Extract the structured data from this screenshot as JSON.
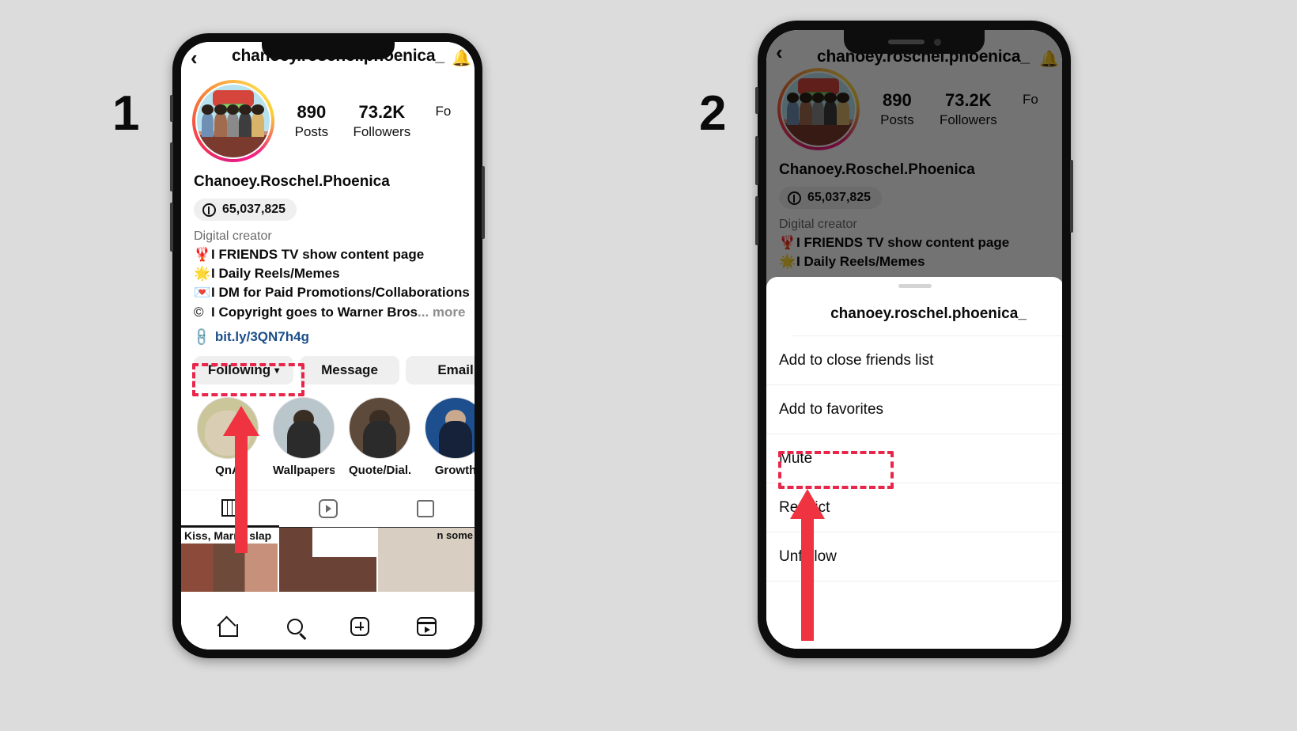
{
  "steps": {
    "one": "1",
    "two": "2"
  },
  "profile": {
    "username": "chanoey.roschel.phoenica_",
    "full_name": "Chanoey.Roschel.Phoenica",
    "threads_count": "65,037,825",
    "category": "Digital creator",
    "bio_lines": [
      {
        "emoji": "🦞",
        "text": "I FRIENDS TV show content page"
      },
      {
        "emoji": "🌟",
        "text": "I Daily Reels/Memes"
      },
      {
        "emoji": "💌",
        "text": "I DM for Paid Promotions/Collaborations"
      },
      {
        "emoji": "©",
        "text": "I Copyright goes to Warner Bros"
      }
    ],
    "bio_more": "... more",
    "link": "bit.ly/3QN7h4g",
    "stats": [
      {
        "value": "890",
        "label": "Posts"
      },
      {
        "value": "73.2K",
        "label": "Followers"
      },
      {
        "value": "",
        "label": "Fo"
      }
    ],
    "actions": {
      "following": "Following",
      "following_caret": "⌄",
      "message": "Message",
      "email": "Email"
    },
    "highlights": [
      {
        "label": "QnA"
      },
      {
        "label": "Wallpapers"
      },
      {
        "label": "Quote/Dial..."
      },
      {
        "label": "Growth"
      }
    ],
    "posts": [
      {
        "caption": "Kiss, Marry, slap"
      },
      {
        "caption": ""
      },
      {
        "caption": "n some"
      }
    ],
    "back_icon": "‹",
    "bell_icon": "🔔"
  },
  "bottom_nav": [
    {
      "name": "home"
    },
    {
      "name": "search"
    },
    {
      "name": "add"
    },
    {
      "name": "reels"
    }
  ],
  "sheet": {
    "title": "chanoey.roschel.phoenica_",
    "items": [
      "Add to close friends list",
      "Add to favorites",
      "Mute",
      "Restrict",
      "Unfollow"
    ]
  },
  "colors": {
    "accent_red": "#e8264a",
    "button_gray": "#efefef",
    "link_blue": "#1b4f8a",
    "background": "#dcdcdc"
  }
}
